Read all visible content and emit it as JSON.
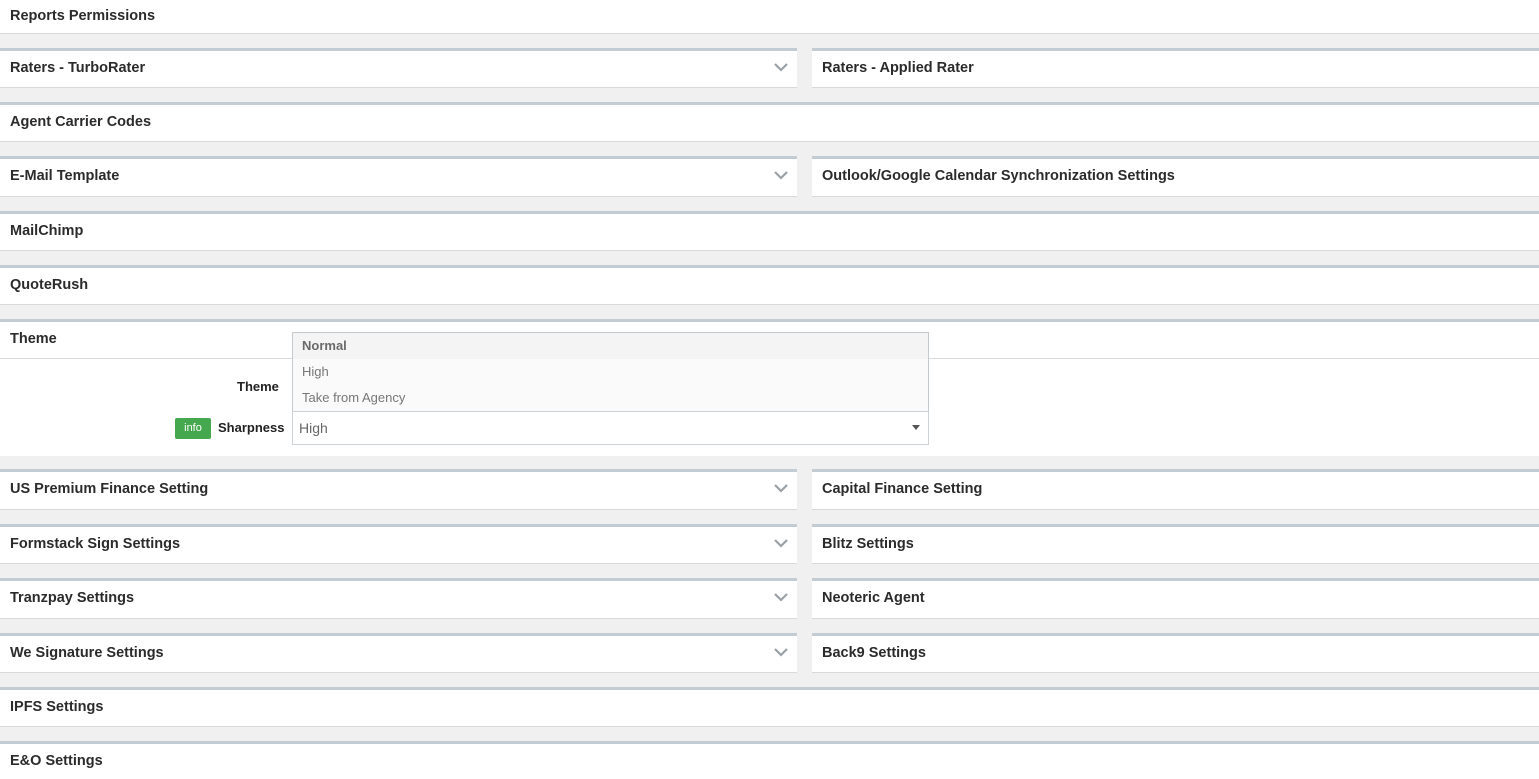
{
  "panels": {
    "reports_permissions": "Reports Permissions",
    "raters_turborater": "Raters - TurboRater",
    "raters_applied_rater": "Raters - Applied Rater",
    "agent_carrier_codes": "Agent Carrier Codes",
    "email_template": "E-Mail Template",
    "calendar_sync": "Outlook/Google Calendar Synchronization Settings",
    "mailchimp": "MailChimp",
    "quoterush": "QuoteRush",
    "theme": "Theme",
    "us_premium_finance": "US Premium Finance Setting",
    "capital_finance": "Capital Finance Setting",
    "formstack_sign": "Formstack Sign Settings",
    "blitz": "Blitz Settings",
    "tranzpay": "Tranzpay Settings",
    "neoteric_agent": "Neoteric Agent",
    "we_signature": "We Signature Settings",
    "back9": "Back9 Settings",
    "ipfs": "IPFS Settings",
    "eo": "E&O Settings"
  },
  "theme_form": {
    "theme_label": "Theme",
    "info_badge": "info",
    "sharpness_label": "Sharpness",
    "sharpness_value": "High",
    "dropdown_options": [
      "Normal",
      "High",
      "Take from Agency"
    ],
    "dropdown_selected": "Normal"
  },
  "colors": {
    "panel_border": "#c3ccd3",
    "info_badge": "#45a84f"
  },
  "icons": {
    "collapse": "chevron-down-icon",
    "select_caret": "caret-down-icon"
  }
}
